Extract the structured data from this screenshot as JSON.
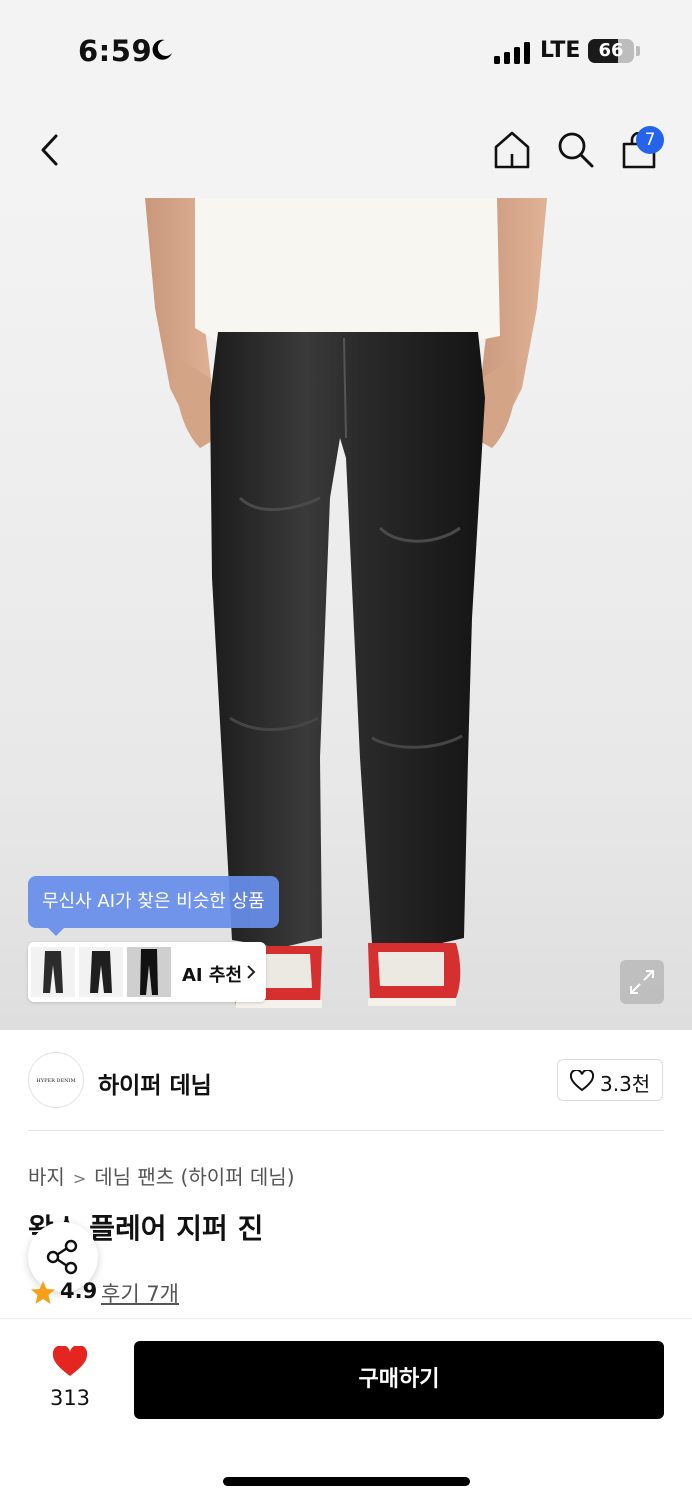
{
  "status_bar": {
    "time": "6:59",
    "network": "LTE",
    "battery": "66",
    "battery_level": 0.66
  },
  "nav": {
    "cart_count": "7",
    "icons": [
      "back-icon",
      "home-icon",
      "search-icon",
      "shopping-bag-icon"
    ]
  },
  "hero": {
    "ai_tooltip": "무신사 AI가 찾은 비슷한 상품",
    "ai_card_label": "AI 추천",
    "expand_icon": "expand-icon"
  },
  "brand": {
    "logo_text": "HYPER DENIM",
    "name": "하이퍼 데님",
    "likes": "3.3천"
  },
  "breadcrumb": [
    "바지",
    "데님 팬츠 (하이퍼 데님)"
  ],
  "product": {
    "title": "왁스 플레어 지퍼 진",
    "rating": "4.9",
    "reviews": "후기 7개"
  },
  "bottom_bar": {
    "wish_count": "313",
    "buy_label": "구매하기"
  },
  "colors": {
    "accent_blue": "#2563eb",
    "heart_red": "#e5251f",
    "star_orange": "#f6a01a",
    "buy_button": "#000000"
  }
}
